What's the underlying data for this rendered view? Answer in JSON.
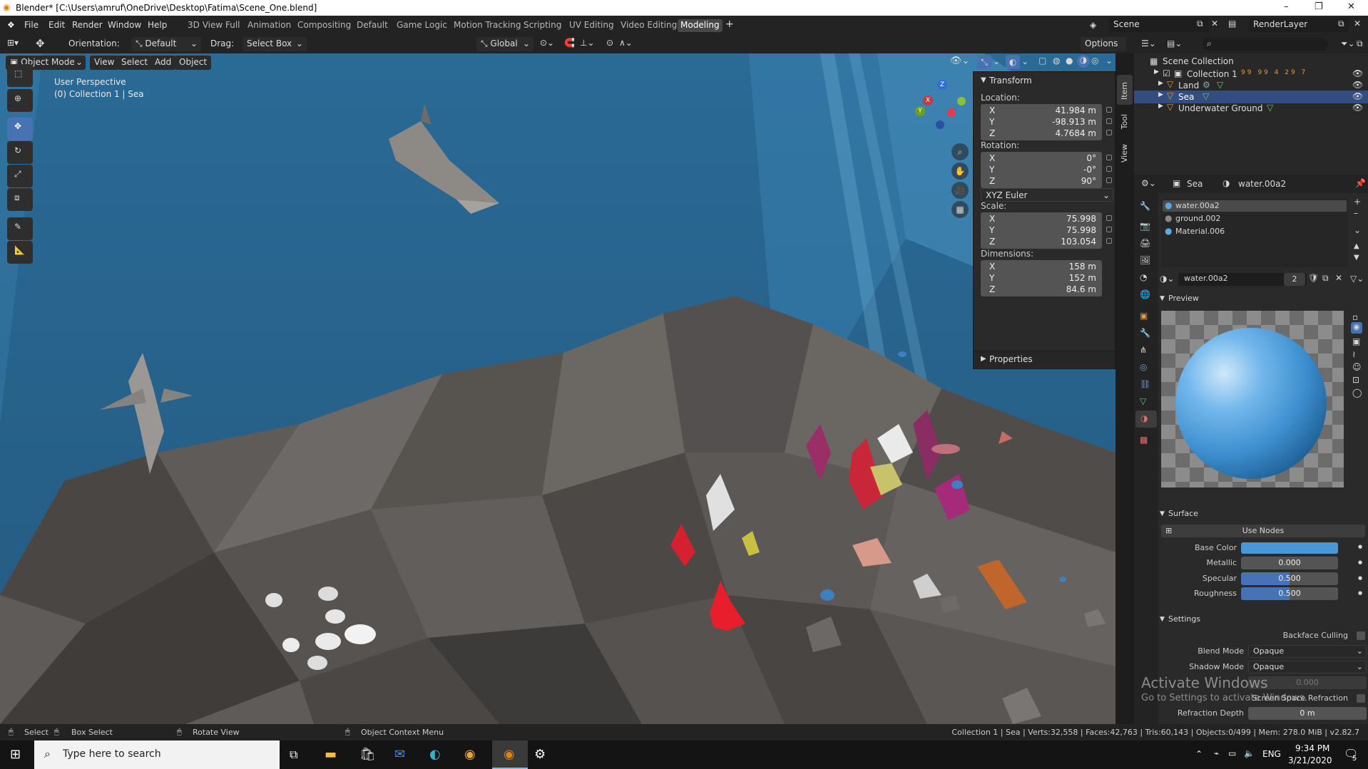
{
  "window": {
    "title": "Blender* [C:\\Users\\amruf\\OneDrive\\Desktop\\Fatima\\Scene_One.blend]",
    "controls": [
      "–",
      "❐",
      "✕"
    ]
  },
  "menu": {
    "items": [
      "File",
      "Edit",
      "Render",
      "Window",
      "Help"
    ]
  },
  "workspaces": [
    "3D View Full",
    "Animation",
    "Compositing",
    "Default",
    "Game Logic",
    "Motion Tracking",
    "Scripting",
    "UV Editing",
    "Video Editing",
    "Modeling"
  ],
  "active_workspace": "Modeling",
  "scene": {
    "name": "Scene",
    "view_layer": "RenderLayer"
  },
  "header": {
    "orientation_label": "Orientation:",
    "orientation_value": "Default",
    "drag_label": "Drag:",
    "drag_value": "Select Box",
    "transform_orientation": "Global",
    "options": "Options"
  },
  "viewport_header": {
    "mode": "Object Mode",
    "menus": [
      "View",
      "Select",
      "Add",
      "Object"
    ]
  },
  "viewport": {
    "perspective": "User Perspective",
    "context": "(0) Collection 1 | Sea"
  },
  "gizmo": {
    "axes": [
      "X",
      "Y",
      "Z"
    ]
  },
  "npanel": {
    "tabs": [
      "Item",
      "Tool",
      "View"
    ],
    "transform_title": "Transform",
    "location_label": "Location:",
    "location": [
      {
        "axis": "X",
        "value": "41.984 m"
      },
      {
        "axis": "Y",
        "value": "-98.913 m"
      },
      {
        "axis": "Z",
        "value": "4.7684 m"
      }
    ],
    "rotation_label": "Rotation:",
    "rotation": [
      {
        "axis": "X",
        "value": "0°"
      },
      {
        "axis": "Y",
        "value": "-0°"
      },
      {
        "axis": "Z",
        "value": "90°"
      }
    ],
    "rotation_mode": "XYZ Euler",
    "scale_label": "Scale:",
    "scale": [
      {
        "axis": "X",
        "value": "75.998"
      },
      {
        "axis": "Y",
        "value": "75.998"
      },
      {
        "axis": "Z",
        "value": "103.054"
      }
    ],
    "dimensions_label": "Dimensions:",
    "dimensions": [
      {
        "axis": "X",
        "value": "158 m"
      },
      {
        "axis": "Y",
        "value": "152 m"
      },
      {
        "axis": "Z",
        "value": "84.6 m"
      }
    ],
    "properties_title": "Properties"
  },
  "outliner": {
    "root": "Scene Collection",
    "items": [
      {
        "label": "Collection 1",
        "badges": "99 99 4 29 7"
      },
      {
        "label": "Land"
      },
      {
        "label": "Sea"
      },
      {
        "label": "Underwater Ground"
      }
    ]
  },
  "properties": {
    "object": "Sea",
    "material": "water.00a2",
    "slots": [
      "water.00a2",
      "ground.002",
      "Material.006"
    ],
    "material_users": "2",
    "preview_title": "Preview",
    "surface_title": "Surface",
    "use_nodes": "Use Nodes",
    "surface": [
      {
        "label": "Base Color",
        "value": ""
      },
      {
        "label": "Metallic",
        "value": "0.000",
        "fill": 0
      },
      {
        "label": "Specular",
        "value": "0.500",
        "fill": 0.5
      },
      {
        "label": "Roughness",
        "value": "0.500",
        "fill": 0.5
      }
    ],
    "base_color": "#4a97d6",
    "settings_title": "Settings",
    "backface_culling": "Backface Culling",
    "blend_mode_label": "Blend Mode",
    "blend_mode": "Opaque",
    "shadow_mode_label": "Shadow Mode",
    "shadow_mode": "Opaque",
    "alpha_value": "0.000",
    "ssr": "Screen Space Refraction",
    "refraction_depth_label": "Refraction Depth",
    "refraction_depth": "0 m"
  },
  "watermark": {
    "line1": "Activate Windows",
    "line2": "Go to Settings to activate Windows."
  },
  "statusbar": {
    "select": "Select",
    "box_select": "Box Select",
    "rotate": "Rotate View",
    "context_menu": "Object Context Menu",
    "stats": "Collection 1 | Sea | Verts:32,558 | Faces:42,763 | Tris:60,143 | Objects:0/499 | Mem: 278.0 MiB | v2.82.7"
  },
  "taskbar": {
    "search_placeholder": "Type here to search",
    "lang": "ENG",
    "time": "9:34 PM",
    "date": "3/21/2020",
    "notif_count": "5"
  }
}
